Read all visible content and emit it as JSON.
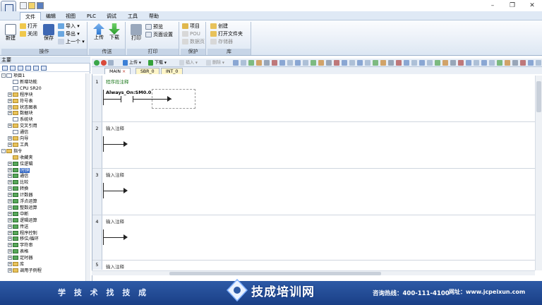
{
  "menubar": {
    "tabs": [
      "文件",
      "编辑",
      "视图",
      "PLC",
      "调试",
      "工具",
      "帮助"
    ],
    "active": "文件"
  },
  "ribbon": {
    "groups": [
      {
        "label": "操作",
        "new": "新建",
        "open": "打开",
        "close": "关闭",
        "save": "保存",
        "import": "导入",
        "export": "导出",
        "recent": "上一个"
      },
      {
        "label": "传送",
        "upload": "上传",
        "download": "下载"
      },
      {
        "label": "打印",
        "print": "打印",
        "preview": "预览",
        "page_setup": "页面设置"
      },
      {
        "label": "保护",
        "project": "项目",
        "pou": "POU",
        "data_page": "数据页"
      },
      {
        "label": "库",
        "create": "创建",
        "open_folder": "打开文件夹",
        "memory": "存储器"
      }
    ]
  },
  "tree": {
    "header": "主要",
    "items": [
      {
        "exp": "-",
        "text": "项目1",
        "icon": "doc",
        "indent": 0
      },
      {
        "exp": "",
        "text": "新增功能",
        "icon": "doc",
        "indent": 1
      },
      {
        "exp": "",
        "text": "CPU SR20",
        "icon": "doc",
        "indent": 1
      },
      {
        "exp": "+",
        "text": "程序块",
        "icon": "folder",
        "indent": 1
      },
      {
        "exp": "+",
        "text": "符号表",
        "icon": "folder",
        "indent": 1
      },
      {
        "exp": "+",
        "text": "状态图表",
        "icon": "folder",
        "indent": 1
      },
      {
        "exp": "+",
        "text": "数据块",
        "icon": "folder",
        "indent": 1
      },
      {
        "exp": "",
        "text": "系统块",
        "icon": "doc",
        "indent": 1
      },
      {
        "exp": "+",
        "text": "交叉引用",
        "icon": "folder",
        "indent": 1
      },
      {
        "exp": "",
        "text": "通信",
        "icon": "doc",
        "indent": 1
      },
      {
        "exp": "+",
        "text": "向导",
        "icon": "folder",
        "indent": 1
      },
      {
        "exp": "+",
        "text": "工具",
        "icon": "folder",
        "indent": 1
      },
      {
        "exp": "-",
        "text": "指令",
        "icon": "folder",
        "indent": 0
      },
      {
        "exp": "",
        "text": "收藏夹",
        "icon": "folder",
        "indent": 1
      },
      {
        "exp": "+",
        "text": "位逻辑",
        "icon": "grn",
        "indent": 1
      },
      {
        "exp": "+",
        "text": "时钟",
        "icon": "grn",
        "indent": 1,
        "selected": true
      },
      {
        "exp": "+",
        "text": "通信",
        "icon": "grn",
        "indent": 1
      },
      {
        "exp": "+",
        "text": "比较",
        "icon": "grn",
        "indent": 1
      },
      {
        "exp": "+",
        "text": "转换",
        "icon": "grn",
        "indent": 1
      },
      {
        "exp": "+",
        "text": "计数器",
        "icon": "grn",
        "indent": 1
      },
      {
        "exp": "+",
        "text": "浮点运算",
        "icon": "grn",
        "indent": 1
      },
      {
        "exp": "+",
        "text": "整数运算",
        "icon": "grn",
        "indent": 1
      },
      {
        "exp": "+",
        "text": "中断",
        "icon": "grn",
        "indent": 1
      },
      {
        "exp": "+",
        "text": "逻辑运算",
        "icon": "grn",
        "indent": 1
      },
      {
        "exp": "+",
        "text": "传送",
        "icon": "grn",
        "indent": 1
      },
      {
        "exp": "+",
        "text": "程序控制",
        "icon": "grn",
        "indent": 1
      },
      {
        "exp": "+",
        "text": "移位/循环",
        "icon": "grn",
        "indent": 1
      },
      {
        "exp": "+",
        "text": "字符串",
        "icon": "grn",
        "indent": 1
      },
      {
        "exp": "+",
        "text": "表格",
        "icon": "grn",
        "indent": 1
      },
      {
        "exp": "+",
        "text": "定时器",
        "icon": "grn",
        "indent": 1
      },
      {
        "exp": "+",
        "text": "库",
        "icon": "folder",
        "indent": 1
      },
      {
        "exp": "+",
        "text": "调用子例程",
        "icon": "folder",
        "indent": 1
      }
    ]
  },
  "editor_toolbar": {
    "upload": "上传",
    "download": "下载",
    "insert": "插入",
    "delete": "删除"
  },
  "editor_tabs": [
    "MAIN",
    "SBR_0",
    "INT_0"
  ],
  "networks": [
    {
      "num": "1",
      "comment": "程序段注释",
      "contact": "Always_On:SM0.0"
    },
    {
      "num": "2",
      "comment": "输入注释"
    },
    {
      "num": "3",
      "comment": "输入注释"
    },
    {
      "num": "4",
      "comment": "输入注释"
    },
    {
      "num": "5",
      "comment": "输入注释"
    }
  ],
  "banner": {
    "slogan": "学 技 术   找 技 成",
    "brand": "技成培训网",
    "hotline": "咨询热线：400-111-4100",
    "website": "网址：www.jcpeixun.com"
  }
}
